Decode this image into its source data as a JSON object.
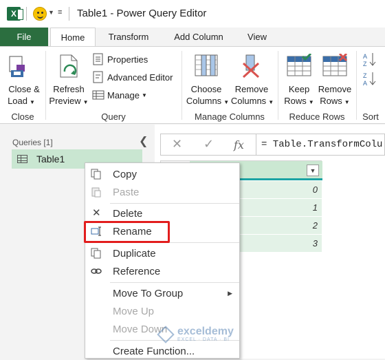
{
  "window": {
    "title": "Table1 - Power Query Editor",
    "app_icon_letter": "X"
  },
  "tabs": [
    {
      "label": "File"
    },
    {
      "label": "Home"
    },
    {
      "label": "Transform"
    },
    {
      "label": "Add Column"
    },
    {
      "label": "View"
    }
  ],
  "ribbon": {
    "close_load": "Close &",
    "close_load_2": "Load",
    "refresh": "Refresh",
    "refresh_2": "Preview",
    "properties": "Properties",
    "advanced_editor": "Advanced Editor",
    "manage": "Manage",
    "choose_columns": "Choose",
    "choose_columns_2": "Columns",
    "remove_columns": "Remove",
    "remove_columns_2": "Columns",
    "keep_rows": "Keep",
    "keep_rows_2": "Rows",
    "remove_rows": "Remove",
    "remove_rows_2": "Rows",
    "groups": {
      "close": "Close",
      "query": "Query",
      "manage_columns": "Manage Columns",
      "reduce_rows": "Reduce Rows",
      "sort": "Sort"
    }
  },
  "queries_pane": {
    "header": "Queries [1]",
    "items": [
      {
        "label": "Table1"
      }
    ]
  },
  "formula_bar": {
    "fx": "fx",
    "formula": "= Table.TransformColu"
  },
  "grid": {
    "rows": [
      {
        "value": "0"
      },
      {
        "value": "1"
      },
      {
        "value": "2"
      },
      {
        "value": "3"
      }
    ]
  },
  "context_menu": {
    "items": [
      {
        "label": "Copy",
        "enabled": true
      },
      {
        "label": "Paste",
        "enabled": false
      },
      {
        "label": "Delete",
        "enabled": true
      },
      {
        "label": "Rename",
        "enabled": true
      },
      {
        "label": "Duplicate",
        "enabled": true
      },
      {
        "label": "Reference",
        "enabled": true
      },
      {
        "label": "Move To Group",
        "enabled": true
      },
      {
        "label": "Move Up",
        "enabled": false
      },
      {
        "label": "Move Down",
        "enabled": false
      },
      {
        "label": "Create Function...",
        "enabled": true
      }
    ]
  },
  "watermark": {
    "name": "exceldemy",
    "tagline": "EXCEL · DATA · BI"
  },
  "colors": {
    "file_tab": "#2b6e3f",
    "selection_green": "#c9e6d1",
    "highlight_red": "#e21d1d"
  }
}
